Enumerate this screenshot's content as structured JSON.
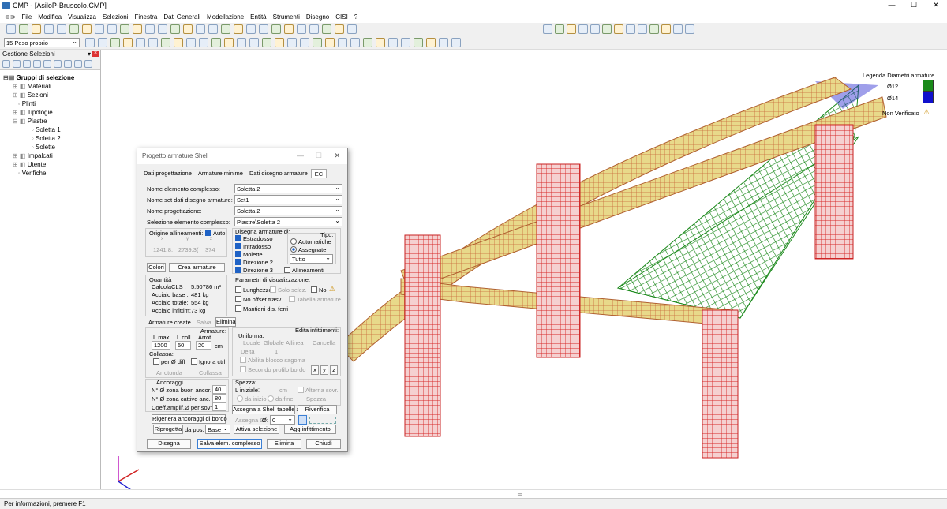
{
  "app": {
    "title": "CMP - [AsiloP-Bruscolo.CMP]",
    "win_buttons": [
      "—",
      "☐",
      "✕"
    ]
  },
  "menu": [
    "File",
    "Modifica",
    "Visualizza",
    "Selezioni",
    "Finestra",
    "Dati Generali",
    "Modellazione",
    "Entità",
    "Strumenti",
    "Disegno",
    "CISI",
    "?"
  ],
  "toolbar2": {
    "load_case": "15 Peso proprio"
  },
  "panel": {
    "title": "Gestione Selezioni",
    "tree": [
      "Gruppi di selezione",
      "Materiali",
      "Sezioni",
      "Plinti",
      "Tipologie",
      "Piastre",
      "Soletta 1",
      "Soletta 2",
      "Solette",
      "Impalcati",
      "Utente",
      "Verifiche"
    ]
  },
  "legend": {
    "title": "Legenda Diametri armature",
    "items": [
      {
        "label": "Ø12",
        "color": "#1a8a1a"
      },
      {
        "label": "Ø14",
        "color": "#1010cc"
      }
    ],
    "nonver": "Non Verificato"
  },
  "dialog": {
    "title": "Progetto armature Shell",
    "tabs": [
      "Dati progettazione",
      "Armature minime",
      "Dati disegno armature",
      "EC"
    ],
    "nome_elem_lbl": "Nome elemento complesso:",
    "nome_elem": "Soletta 2",
    "nome_set_lbl": "Nome set dati disegno armature:",
    "nome_set": "Set1",
    "nome_prog_lbl": "Nome progettazione:",
    "nome_prog": "Soletta 2",
    "sel_elem_lbl": "Selezione elemento complesso:",
    "sel_elem": "Piastre\\Soletta 2",
    "origine_lbl": "Origine allineamenti:",
    "auto": "Auto",
    "xyz_labels": [
      "x",
      "y",
      "z"
    ],
    "xyz": [
      "1241.8:",
      "2739.3(",
      "374"
    ],
    "colori": "Colori",
    "crea": "Crea armature",
    "quantita": "Quantità",
    "q_labels": [
      "Calcola",
      "CLS :",
      "Acciaio base :",
      "Acciaio totale:",
      "Acciaio infittim:"
    ],
    "q_values": [
      "5.50786 m³",
      "481 kg",
      "554 kg",
      "73 kg"
    ],
    "disegna_lbl": "Disegna armature di:",
    "disegna_items": [
      "Estradosso",
      "Intradosso",
      "Moiette",
      "Direzione 2",
      "Direzione 3"
    ],
    "allineamenti": "Allineamenti",
    "tipo_lbl": "Tipo:",
    "automatiche": "Automatiche",
    "assegnate": "Assegnate",
    "tutto": "Tutto",
    "param_lbl": "Parametri di visualizzazione:",
    "lunghezze": "Lunghezze",
    "solo_selez": "Solo selez.",
    "no": "No",
    "no_offset": "No offset trasv.",
    "tabella": "Tabella armature",
    "mantieni": "Mantieni dis. ferri",
    "arm_create": "Armature create",
    "salva": "Salva",
    "elimina_tab": "Elimina",
    "armature_lbl": "Armature:",
    "lmax": "L.max",
    "lcoll": "L.coll.",
    "arrot": "Arrot.",
    "lmax_v": "1200",
    "lcoll_v": "50",
    "arrot_v": "20",
    "cm": "cm",
    "collassa_lbl": "Collassa:",
    "per_diff": "per Ø diff",
    "ignora": "Ignora ctrl",
    "arrotonda": "Arrotonda",
    "collassa": "Collassa",
    "edita": "Edita infittimenti:",
    "uniforma": "Uniforma:",
    "locale": "Locale",
    "globale": "Globale",
    "allinea": "Allinea",
    "cancella": "Cancella",
    "delta": "Delta",
    "delta_v": "1",
    "abilita": "Abilita blocco sagoma",
    "secondo": "Secondo profilo bordo",
    "xyzbtn": [
      "x",
      "y",
      "z"
    ],
    "ancoraggi": "Ancoraggi",
    "zona_buon": "N° Ø zona buon ancor.",
    "zona_buon_v": "40",
    "zona_catt": "N° Ø zona cattivo anc.",
    "zona_catt_v": "80",
    "coeff": "Coeff.amplif.Ø per sovr.",
    "coeff_v": "1",
    "spezza_lbl": "Spezza:",
    "l_iniziale": "L iniziale",
    "l_iniz_v": "0",
    "cm2": "cm",
    "alterna": "Alterna sovr.",
    "da_inizio": "da inizio",
    "da_fine": "da fine",
    "spezza": "Spezza",
    "ridgenera": "Rigenera ancoraggi di bordo",
    "assegna_shell": "Assegna a Shell tabelle armat.",
    "riverifica": "Riverifica",
    "assegna_d": "Assegna Ø",
    "d_lbl": "Ø:",
    "d_v": "0",
    "riprogetta": "Riprogetta",
    "da_pos": "da pos:",
    "base": "Base",
    "attiva": "Attiva selezione",
    "agg_inf": "Agg.infittimento",
    "b_disegna": "Disegna",
    "b_salva": "Salva elem. complesso",
    "b_elimina": "Elimina",
    "b_chiudi": "Chiudi"
  },
  "status": "Per informazioni, premere F1"
}
